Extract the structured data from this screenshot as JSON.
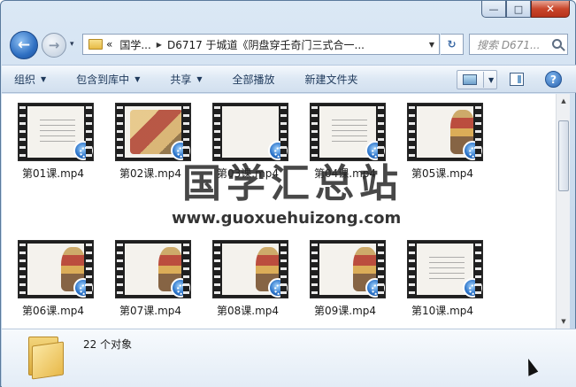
{
  "window": {
    "caption_buttons": [
      {
        "name": "minimize-button",
        "glyph": "—"
      },
      {
        "name": "maximize-button",
        "glyph": "□"
      },
      {
        "name": "close-button",
        "glyph": "✕"
      }
    ]
  },
  "nav": {
    "back_glyph": "←",
    "forward_glyph": "→",
    "history_glyph": "▾"
  },
  "address": {
    "prefix": "«",
    "parts": [
      "国学...",
      "D6717 于城道《阴盘穿壬奇门三式合一..."
    ],
    "separator": "▶",
    "dropdown": "▼",
    "refresh_glyph": "↻"
  },
  "search": {
    "placeholder": "搜索 D671..."
  },
  "commands": [
    {
      "label": "组织",
      "menu": true
    },
    {
      "label": "包含到库中",
      "menu": true
    },
    {
      "label": "共享",
      "menu": true
    },
    {
      "label": "全部播放",
      "menu": false
    },
    {
      "label": "新建文件夹",
      "menu": false
    }
  ],
  "view_menu_glyph": "▼",
  "help_glyph": "?",
  "scroll": {
    "up": "▲",
    "down": "▼"
  },
  "files": [
    {
      "name": "第01课.mp4",
      "thumb": "doc"
    },
    {
      "name": "第02课.mp4",
      "thumb": "wide"
    },
    {
      "name": "第03课.mp4",
      "thumb": "blank"
    },
    {
      "name": "第04课.mp4",
      "thumb": "doc"
    },
    {
      "name": "第05课.mp4",
      "thumb": "figure"
    },
    {
      "name": "第06课.mp4",
      "thumb": "figure"
    },
    {
      "name": "第07课.mp4",
      "thumb": "figure"
    },
    {
      "name": "第08课.mp4",
      "thumb": "figure"
    },
    {
      "name": "第09课.mp4",
      "thumb": "figure"
    },
    {
      "name": "第10课.mp4",
      "thumb": "doc"
    }
  ],
  "watermark": {
    "title": "国学汇总站",
    "url": "www.guoxuehuizong.com"
  },
  "details": {
    "count_text": "22 个对象"
  },
  "colors": {
    "accent": "#2b73c9",
    "command_text": "#1e395b"
  }
}
